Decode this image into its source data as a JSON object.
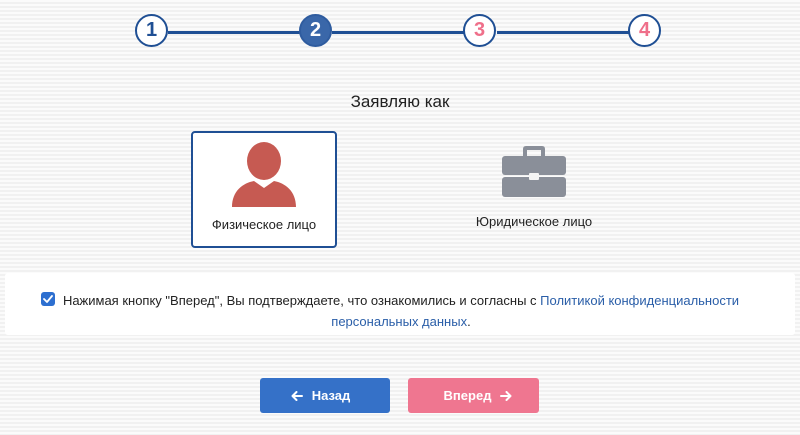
{
  "stepper": {
    "steps": [
      {
        "label": "1",
        "state": "done"
      },
      {
        "label": "2",
        "state": "active"
      },
      {
        "label": "3",
        "state": "future"
      },
      {
        "label": "4",
        "state": "future"
      }
    ],
    "colors": {
      "line": "#1f4f94",
      "active": "#3a67a9",
      "future_text": "#ef6f8a"
    }
  },
  "applicant": {
    "heading": "Заявляю как",
    "options": [
      {
        "label": "Физическое лицо",
        "icon": "person-icon",
        "selected": true
      },
      {
        "label": "Юридическое лицо",
        "icon": "briefcase-icon",
        "selected": false
      }
    ]
  },
  "consent": {
    "checked": true,
    "text_before": "Нажимая кнопку \"Вперед\", Вы подтверждаете, что ознакомились и согласны с ",
    "link_text": "Политикой конфиденциальности персональных данных",
    "text_after": "."
  },
  "nav": {
    "back_label": "Назад",
    "next_label": "Вперед",
    "colors": {
      "back": "#3571c8",
      "next": "#ef7690"
    }
  }
}
